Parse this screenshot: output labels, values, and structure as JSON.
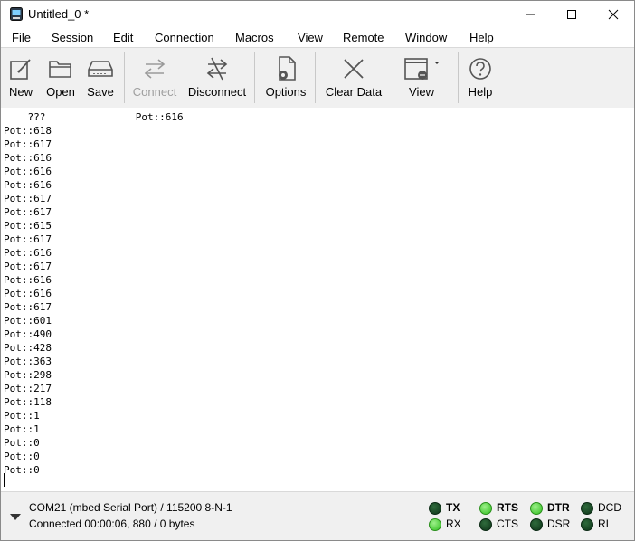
{
  "window": {
    "title": "Untitled_0 *",
    "controls": {
      "minimize": "–",
      "maximize": "☐",
      "close": "✕"
    }
  },
  "menu": [
    {
      "label": "File",
      "mnemonic": "F",
      "rest": "ile"
    },
    {
      "label": "Session",
      "mnemonic": "S",
      "rest": "ession"
    },
    {
      "label": "Edit",
      "mnemonic": "E",
      "rest": "dit"
    },
    {
      "label": "Connection",
      "mnemonic": "C",
      "rest": "onnection"
    },
    {
      "label": "Macros",
      "mnemonic": "",
      "rest": "Macros"
    },
    {
      "label": "View",
      "mnemonic": "V",
      "rest": "iew"
    },
    {
      "label": "Remote",
      "mnemonic": "",
      "rest": "Remote"
    },
    {
      "label": "Window",
      "mnemonic": "W",
      "rest": "indow"
    },
    {
      "label": "Help",
      "mnemonic": "H",
      "rest": "elp"
    }
  ],
  "toolbar": {
    "new": "New",
    "open": "Open",
    "save": "Save",
    "connect": "Connect",
    "disconnect": "Disconnect",
    "options": "Options",
    "clear_data": "Clear Data",
    "view": "View",
    "help": "Help"
  },
  "terminal": {
    "lines": [
      "    ???               Pot::616",
      "Pot::618",
      "Pot::617",
      "Pot::616",
      "Pot::616",
      "Pot::616",
      "Pot::617",
      "Pot::617",
      "Pot::615",
      "Pot::617",
      "Pot::616",
      "Pot::617",
      "Pot::616",
      "Pot::616",
      "Pot::617",
      "Pot::601",
      "Pot::490",
      "Pot::428",
      "Pot::363",
      "Pot::298",
      "Pot::217",
      "Pot::118",
      "Pot::1",
      "Pot::1",
      "Pot::0",
      "Pot::0",
      "Pot::0"
    ]
  },
  "status": {
    "port": "COM21 (mbed Serial Port) / 115200 8-N-1",
    "connection": "Connected 00:00:06, 880 / 0 bytes",
    "leds": {
      "tx": {
        "label": "TX",
        "on": false
      },
      "rx": {
        "label": "RX",
        "on": true
      },
      "rts": {
        "label": "RTS",
        "on": true
      },
      "cts": {
        "label": "CTS",
        "on": false
      },
      "dtr": {
        "label": "DTR",
        "on": true
      },
      "dsr": {
        "label": "DSR",
        "on": false
      },
      "dcd": {
        "label": "DCD",
        "on": false
      },
      "ri": {
        "label": "RI",
        "on": false
      }
    }
  },
  "colors": {
    "led_on": "#3fcf2a",
    "led_off": "#1e4d2a",
    "toolbar_bg": "#f0f0f0",
    "disabled_text": "#9e9e9e"
  }
}
